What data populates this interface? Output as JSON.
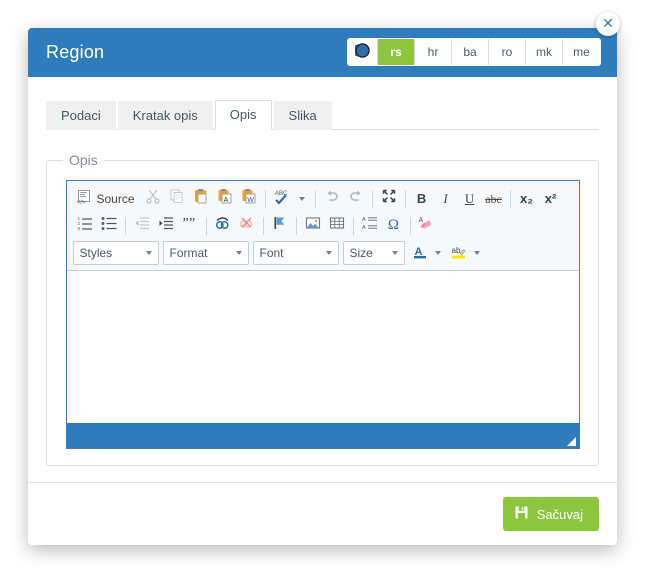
{
  "modal": {
    "title": "Region",
    "close_label": "✕"
  },
  "languages": {
    "globe_icon": "globe-icon",
    "items": [
      {
        "code": "rs",
        "active": true
      },
      {
        "code": "hr",
        "active": false
      },
      {
        "code": "ba",
        "active": false
      },
      {
        "code": "ro",
        "active": false
      },
      {
        "code": "mk",
        "active": false
      },
      {
        "code": "me",
        "active": false
      }
    ]
  },
  "tabs": [
    {
      "label": "Podaci",
      "active": false
    },
    {
      "label": "Kratak opis",
      "active": false
    },
    {
      "label": "Opis",
      "active": true
    },
    {
      "label": "Slika",
      "active": false
    }
  ],
  "fieldset": {
    "legend": "Opis"
  },
  "editor": {
    "source_label": "Source",
    "content": "",
    "row1": [
      {
        "name": "source-button",
        "label": "Source",
        "icon": "source-code-icon"
      },
      {
        "name": "cut-button",
        "icon": "scissors-icon",
        "disabled": true
      },
      {
        "name": "copy-button",
        "icon": "copy-icon",
        "disabled": true
      },
      {
        "name": "paste-button",
        "icon": "clipboard-icon"
      },
      {
        "name": "paste-as-text-button",
        "icon": "clipboard-text-icon"
      },
      {
        "name": "paste-from-word-button",
        "icon": "clipboard-word-icon"
      },
      {
        "name": "spellcheck-button",
        "icon": "spellcheck-abc-icon"
      },
      {
        "name": "undo-button",
        "icon": "undo-arrow-icon",
        "disabled": true
      },
      {
        "name": "redo-button",
        "icon": "redo-arrow-icon",
        "disabled": true
      },
      {
        "name": "maximize-button",
        "icon": "maximize-icon"
      },
      {
        "name": "bold-button",
        "label": "B"
      },
      {
        "name": "italic-button",
        "label": "I"
      },
      {
        "name": "underline-button",
        "label": "U"
      },
      {
        "name": "strikethrough-button",
        "label": "abc"
      },
      {
        "name": "subscript-button",
        "label": "x₂"
      },
      {
        "name": "superscript-button",
        "label": "x²"
      }
    ],
    "row2": [
      {
        "name": "numbered-list-button",
        "icon": "numbered-list-icon"
      },
      {
        "name": "bulleted-list-button",
        "icon": "bulleted-list-icon"
      },
      {
        "name": "outdent-button",
        "icon": "outdent-icon",
        "disabled": true
      },
      {
        "name": "indent-button",
        "icon": "indent-icon"
      },
      {
        "name": "blockquote-button",
        "icon": "quote-icon"
      },
      {
        "name": "link-button",
        "icon": "link-chain-icon"
      },
      {
        "name": "unlink-button",
        "icon": "unlink-icon",
        "disabled": true
      },
      {
        "name": "anchor-button",
        "icon": "flag-anchor-icon"
      },
      {
        "name": "image-button",
        "icon": "image-icon"
      },
      {
        "name": "table-button",
        "icon": "table-icon"
      },
      {
        "name": "definition-list-button",
        "icon": "definition-list-icon"
      },
      {
        "name": "special-char-button",
        "icon": "omega-icon"
      },
      {
        "name": "remove-format-button",
        "icon": "eraser-icon"
      }
    ],
    "dropdowns": [
      {
        "name": "styles-dropdown",
        "label": "Styles"
      },
      {
        "name": "format-dropdown",
        "label": "Format"
      },
      {
        "name": "font-dropdown",
        "label": "Font"
      },
      {
        "name": "size-dropdown",
        "label": "Size"
      }
    ],
    "color_buttons": [
      {
        "name": "text-color-button",
        "label": "A",
        "color": "#2f6ca8"
      },
      {
        "name": "background-color-button",
        "label": "ab",
        "color": "#f5e800"
      }
    ],
    "resize_handle": "resize-grip"
  },
  "footer": {
    "save_label": "Sačuvaj",
    "save_icon": "floppy-save-icon"
  },
  "colors": {
    "header_blue": "#2f7cbd",
    "accent_green": "#8cc63e",
    "editor_border": "#3f7eb8"
  }
}
